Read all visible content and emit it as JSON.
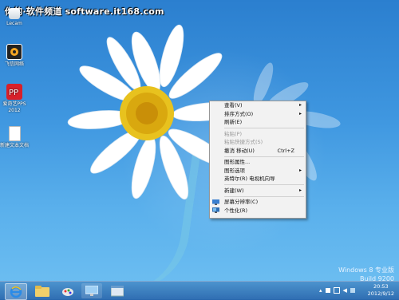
{
  "watermark": "你的·软件频道 software.it168.com",
  "desktop_icons": [
    {
      "label": "Lecam",
      "icon": "lecam-icon"
    },
    {
      "label": "飞信网络",
      "icon": "app-icon"
    },
    {
      "label": "爱奇艺PPS 2012",
      "icon": "video-app-icon"
    },
    {
      "label": "新建文本文档",
      "icon": "text-document-icon"
    }
  ],
  "context_menu": {
    "items": [
      {
        "label": "查看(V)",
        "submenu": true,
        "disabled": false
      },
      {
        "label": "排序方式(O)",
        "submenu": true,
        "disabled": false
      },
      {
        "label": "刷新(E)",
        "submenu": false,
        "disabled": false
      },
      {
        "sep": true
      },
      {
        "label": "粘贴(P)",
        "submenu": false,
        "disabled": true
      },
      {
        "label": "粘贴快捷方式(S)",
        "submenu": false,
        "disabled": true
      },
      {
        "label": "撤消 移动(U)",
        "shortcut": "Ctrl+Z",
        "submenu": false,
        "disabled": false
      },
      {
        "sep": true
      },
      {
        "label": "图形属性...",
        "submenu": false,
        "disabled": false
      },
      {
        "label": "图形选项",
        "submenu": true,
        "disabled": false
      },
      {
        "label": "英特尔(R) 电视机向导",
        "submenu": false,
        "disabled": false
      },
      {
        "sep": true
      },
      {
        "label": "新建(W)",
        "submenu": true,
        "disabled": false
      },
      {
        "sep": true
      },
      {
        "label": "屏幕分辨率(C)",
        "icon": "display-icon",
        "submenu": false,
        "disabled": false
      },
      {
        "label": "个性化(R)",
        "icon": "personalize-icon",
        "submenu": false,
        "disabled": false
      }
    ]
  },
  "windows_info": {
    "edition": "Windows 8 专业版",
    "build": "Build 9200"
  },
  "taskbar": {
    "buttons": [
      {
        "name": "ie-icon"
      },
      {
        "name": "file-explorer-icon"
      },
      {
        "name": "paint-icon"
      },
      {
        "name": "remote-desktop-icon"
      },
      {
        "name": "app-window-icon"
      }
    ],
    "clock": {
      "time": "20:53",
      "date": "2012/9/12"
    }
  },
  "colors": {
    "accent": "#3f97e0",
    "menu_bg": "#f2f2f2"
  }
}
